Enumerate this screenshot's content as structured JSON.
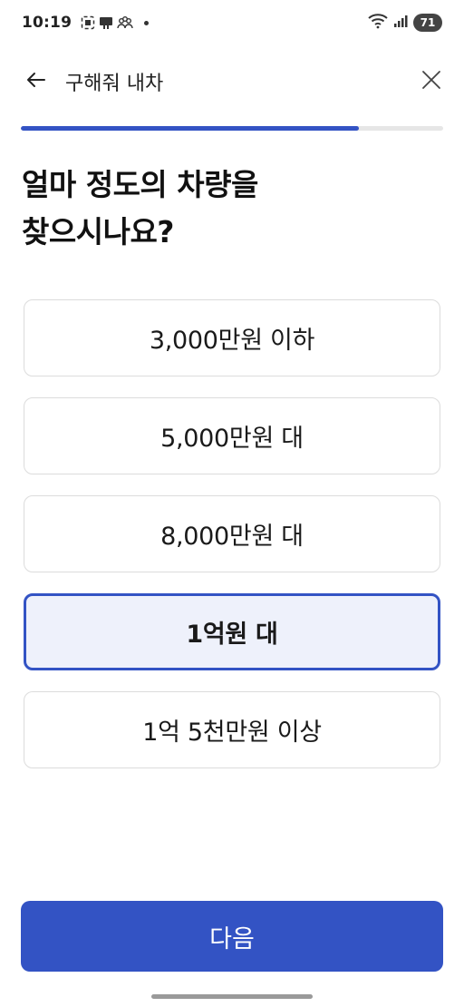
{
  "status_bar": {
    "time": "10:19",
    "battery": "71",
    "icons": [
      "screenshot-icon",
      "card-icon",
      "people-icon",
      "wifi-icon",
      "signal-icon",
      "battery-icon"
    ]
  },
  "header": {
    "title": "구해줘 내차",
    "back_icon": "arrow-left-icon",
    "close_icon": "close-icon"
  },
  "progress": {
    "fraction": 0.8
  },
  "question": {
    "line1_prefix": "얼마 정도의 ",
    "line1_emphasis": "차량",
    "line1_suffix": "을",
    "line2": "찾으시나요?"
  },
  "options": [
    {
      "label": "3,000만원 이하",
      "selected": false
    },
    {
      "label": "5,000만원 대",
      "selected": false
    },
    {
      "label": "8,000만원 대",
      "selected": false
    },
    {
      "label": "1억원 대",
      "selected": true
    },
    {
      "label": "1억 5천만원 이상",
      "selected": false
    }
  ],
  "next_button": {
    "label": "다음"
  },
  "colors": {
    "accent": "#3353c4",
    "selected_bg": "#eef1fb",
    "border": "#dcdcdc",
    "track": "#e6e6e6"
  }
}
